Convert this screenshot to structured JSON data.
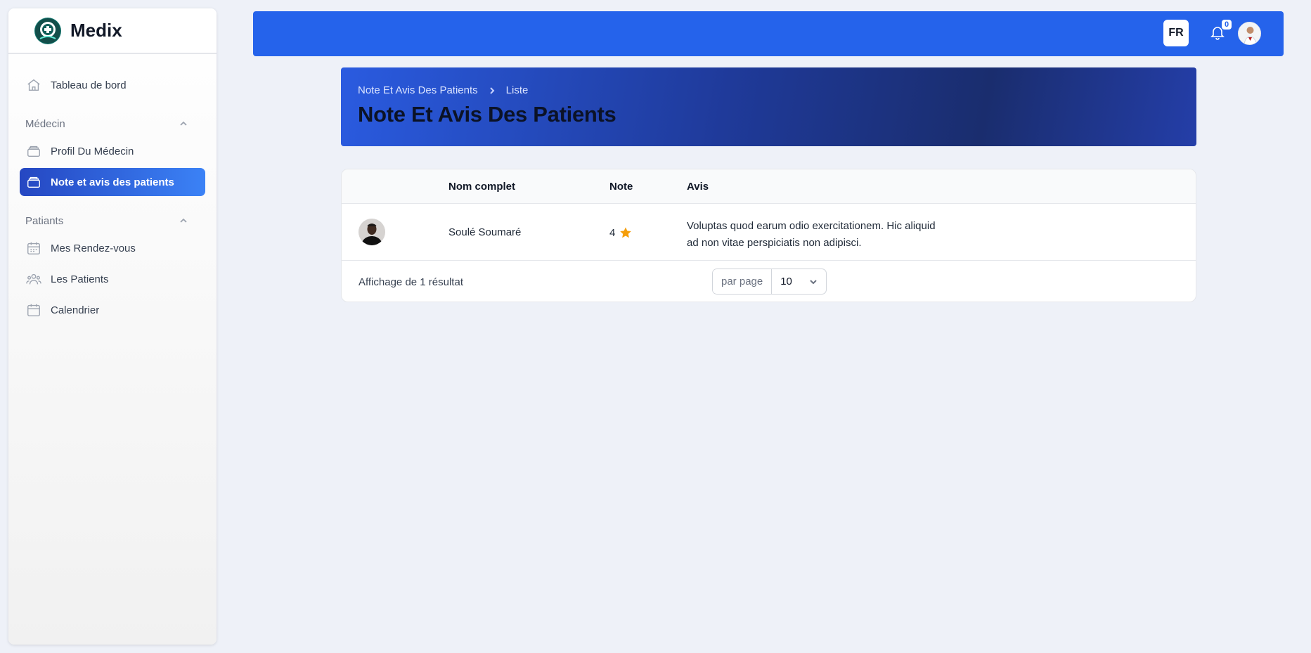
{
  "brand": {
    "name": "Medix",
    "logo_icon": "medical-logo-icon"
  },
  "sidebar": {
    "top_item": {
      "label": "Tableau de bord",
      "icon": "home-icon"
    },
    "groups": [
      {
        "title": "Médecin",
        "items": [
          {
            "label": "Profil Du Médecin",
            "icon": "box-icon"
          },
          {
            "label": "Note et avis des patients",
            "icon": "box-icon",
            "active": true
          }
        ]
      },
      {
        "title": "Patiants",
        "items": [
          {
            "label": "Mes Rendez-vous",
            "icon": "calendar-days-icon"
          },
          {
            "label": "Les Patients",
            "icon": "users-icon"
          },
          {
            "label": "Calendrier",
            "icon": "calendar-icon"
          }
        ]
      }
    ]
  },
  "topbar": {
    "language": "FR",
    "notifications_count": "0",
    "accent": "#2563eb"
  },
  "header": {
    "breadcrumb": [
      "Note Et Avis Des Patients",
      "Liste"
    ],
    "title": "Note Et Avis Des Patients"
  },
  "table": {
    "columns": [
      "",
      "Nom complet",
      "Note",
      "Avis"
    ],
    "rows": [
      {
        "name": "Soulé Soumaré",
        "note": "4",
        "avis": "Voluptas quod earum odio exercitationem. Hic aliquid ad non vitae perspiciatis non adipisci."
      }
    ],
    "footer": {
      "result_text": "Affichage de 1 résultat",
      "per_page_label": "par page",
      "per_page_value": "10"
    }
  },
  "colors": {
    "star": "#f59e0b",
    "active_nav": "#2547c2"
  }
}
